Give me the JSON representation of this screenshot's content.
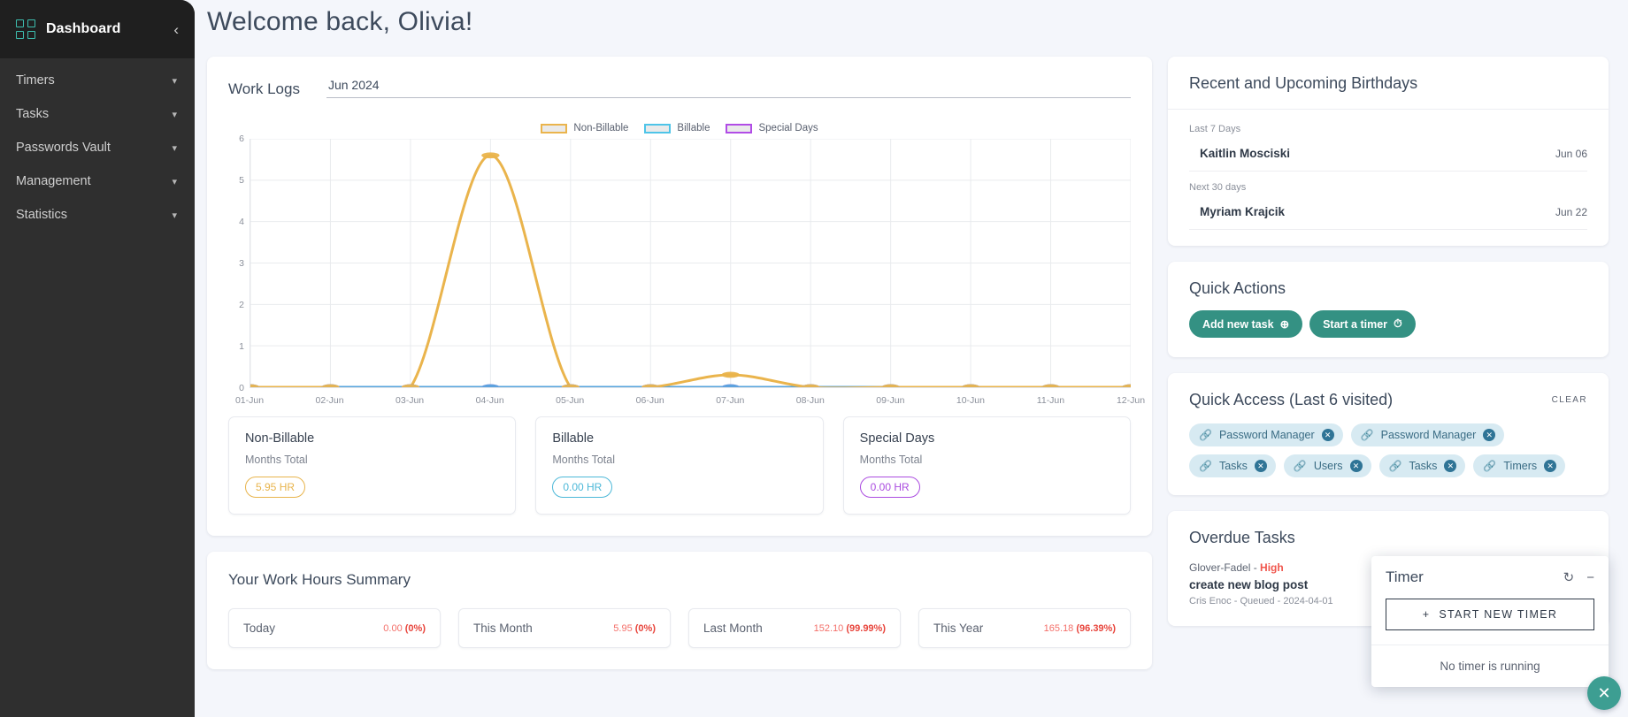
{
  "sidebar": {
    "brand": "Dashboard",
    "collapse_icon": "chevron-left-icon",
    "items": [
      {
        "label": "Timers",
        "chevron": "⌄"
      },
      {
        "label": "Tasks",
        "chevron": "⌄"
      },
      {
        "label": "Passwords Vault",
        "chevron": "⌄"
      },
      {
        "label": "Management",
        "chevron": "⌄"
      },
      {
        "label": "Statistics",
        "chevron": "⌄"
      }
    ]
  },
  "header": {
    "welcome": "Welcome back, Olivia!"
  },
  "work_logs": {
    "title": "Work Logs",
    "date_value": "Jun 2024",
    "date_placeholder": "Jun 2024"
  },
  "totals": [
    {
      "name": "Non-Billable",
      "sub": "Months Total",
      "value": "5.95 HR",
      "color": "#e8b44c"
    },
    {
      "name": "Billable",
      "sub": "Months Total",
      "value": "0.00 HR",
      "color": "#4cb8d8"
    },
    {
      "name": "Special Days",
      "sub": "Months Total",
      "value": "0.00 HR",
      "color": "#ab4ce0"
    }
  ],
  "work_hours_summary": {
    "title": "Your Work Hours Summary",
    "items": [
      {
        "label": "Today",
        "value": "0.00 ",
        "pct": "(0%)"
      },
      {
        "label": "This Month",
        "value": "5.95 ",
        "pct": "(0%)"
      },
      {
        "label": "Last Month",
        "value": "152.10 ",
        "pct": "(99.99%)"
      },
      {
        "label": "This Year",
        "value": "165.18 ",
        "pct": "(96.39%)"
      }
    ]
  },
  "birthdays": {
    "title": "Recent and Upcoming Birthdays",
    "groups": [
      {
        "label": "Last 7 Days",
        "rows": [
          {
            "name": "Kaitlin Mosciski",
            "date": "Jun 06"
          }
        ]
      },
      {
        "label": "Next 30 days",
        "rows": [
          {
            "name": "Myriam Krajcik",
            "date": "Jun 22"
          }
        ]
      }
    ]
  },
  "quick_actions": {
    "title": "Quick Actions",
    "buttons": [
      {
        "label": "Add new task",
        "icon": "plus-circle-icon",
        "glyph": "⊕"
      },
      {
        "label": "Start a timer",
        "icon": "alarm-clock-icon",
        "glyph": "⏱"
      }
    ]
  },
  "quick_access": {
    "title": "Quick Access (Last 6 visited)",
    "clear_label": "CLEAR",
    "chips": [
      {
        "label": "Password Manager"
      },
      {
        "label": "Password Manager"
      },
      {
        "label": "Tasks"
      },
      {
        "label": "Users"
      },
      {
        "label": "Tasks"
      },
      {
        "label": "Timers"
      }
    ]
  },
  "overdue_tasks": {
    "title": "Overdue Tasks",
    "items": [
      {
        "project": "Glover-Fadel - ",
        "priority": "High",
        "name": "create new blog post",
        "sub": "Cris Enoc - Queued - 2024-04-01"
      }
    ]
  },
  "timer_widget": {
    "title": "Timer",
    "refresh_icon": "refresh-icon",
    "minimize_icon": "minimize-icon",
    "start_label": "START NEW TIMER",
    "start_glyph": "+",
    "status": "No timer is running",
    "fab_icon": "close-icon",
    "fab_glyph": "✕"
  },
  "chart_data": {
    "type": "line",
    "title": "Work Logs",
    "xlabel": "",
    "ylabel": "",
    "ylim": [
      0,
      6
    ],
    "yticks": [
      0,
      1,
      2,
      3,
      4,
      5,
      6
    ],
    "grid": true,
    "legend_position": "top-center",
    "categories": [
      "01-Jun",
      "02-Jun",
      "03-Jun",
      "04-Jun",
      "05-Jun",
      "06-Jun",
      "07-Jun",
      "08-Jun",
      "09-Jun",
      "10-Jun",
      "11-Jun",
      "12-Jun"
    ],
    "series": [
      {
        "name": "Non-Billable",
        "color": "#eab44c",
        "values": [
          0,
          0,
          0,
          5.6,
          0,
          0,
          0.3,
          0,
          0,
          0,
          0,
          0
        ]
      },
      {
        "name": "Billable",
        "color": "#58a6dd",
        "values": [
          0,
          0,
          0,
          0,
          0,
          0,
          0,
          0,
          0,
          0,
          0,
          0
        ]
      },
      {
        "name": "Special Days",
        "color": "#b14ce6",
        "values": [
          0,
          0,
          0,
          0,
          0,
          0,
          0,
          0,
          0,
          0,
          0,
          0
        ]
      }
    ]
  }
}
